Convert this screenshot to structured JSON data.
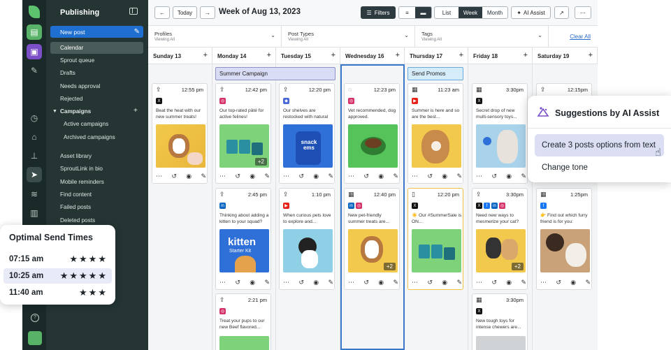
{
  "nav": {
    "title": "Publishing",
    "new_post": "New post",
    "items": [
      "Calendar",
      "Sprout queue",
      "Drafts",
      "Needs approval",
      "Rejected"
    ],
    "campaigns": "Campaigns",
    "campaign_items": [
      "Active campaigns",
      "Archived campaigns"
    ],
    "more": [
      "Asset library",
      "SproutLink in bio",
      "Mobile reminders",
      "Find content",
      "Failed posts",
      "Deleted posts"
    ]
  },
  "toolbar": {
    "today": "Today",
    "week_title": "Week of Aug 13, 2023",
    "filters": "Filters",
    "views": [
      "List",
      "Week",
      "Month"
    ],
    "active_view": "Week",
    "ai_assist": "AI Assist"
  },
  "filters": [
    {
      "label": "Profiles",
      "sub": "Viewing All"
    },
    {
      "label": "Post Types",
      "sub": "Viewing All"
    },
    {
      "label": "Tags",
      "sub": "Viewing All"
    }
  ],
  "clear_all": "Clear All",
  "days": [
    "Sunday 13",
    "Monday 14",
    "Tuesday 15",
    "Wednesday 16",
    "Thursday 17",
    "Friday 18",
    "Saturday 19"
  ],
  "banners": {
    "summer": "Summer Campaign",
    "promos": "Send Promos"
  },
  "cards": {
    "sun1": {
      "time": "12:55 pm",
      "text": "Beat the heat with our new summer treats!"
    },
    "mon1": {
      "time": "12:42 pm",
      "text": "Our top-rated pâté for active felines!",
      "more": "+2"
    },
    "mon2": {
      "time": "2:45 pm",
      "text": "Thinking about adding a kitten to your squad?",
      "img_title": "kitten",
      "img_sub": "Starter Kit"
    },
    "mon3": {
      "time": "2:21 pm",
      "text": "Treat your pups to our new Beef flavored..."
    },
    "tue1": {
      "time": "12:20 pm",
      "text": "Our shelves are restocked with natural",
      "img_title": "snack ems"
    },
    "tue2": {
      "time": "1:10 pm",
      "text": "When curious pets love to explore and..."
    },
    "wed1": {
      "time": "12:23 pm",
      "text": "Vet recommended, dog approved."
    },
    "wed2": {
      "time": "12:40 pm",
      "text": "New pet-friendly summer treats are...",
      "more": "+2"
    },
    "thu1": {
      "time": "11:23 am",
      "text": "Summer is here and so are the best..."
    },
    "thu2": {
      "time": "12:20 pm",
      "text": "☀️ Our #SummerSale is ON..."
    },
    "fri1": {
      "time": "3:30pm",
      "text": "Secret drop of new multi-sensory toys..."
    },
    "fri2": {
      "time": "3:30pm",
      "text": "Need new ways to mesmerize your cat?",
      "more": "+2"
    },
    "fri3": {
      "time": "3:30pm",
      "text": "New tough toys for intense chewers are..."
    },
    "sat1": {
      "time": "12:15pm"
    },
    "sat2": {
      "time": "1:25pm",
      "text": "👉 Find out which furry friend is for you:"
    }
  },
  "optimal": {
    "title": "Optimal Send Times",
    "times": [
      {
        "time": "07:15 am",
        "stars": "★★★★"
      },
      {
        "time": "10:25 am",
        "stars": "★★★★★"
      },
      {
        "time": "11:40 am",
        "stars": "★★★"
      }
    ]
  },
  "ai_popup": {
    "title": "Suggestions by AI Assist",
    "option1": "Create 3 posts options from text",
    "option2": "Change tone"
  },
  "colors": {
    "accent": "#1f6fd1",
    "sidebar": "#243533",
    "rail": "#1a2a28",
    "highlight": "#3a77c9"
  }
}
